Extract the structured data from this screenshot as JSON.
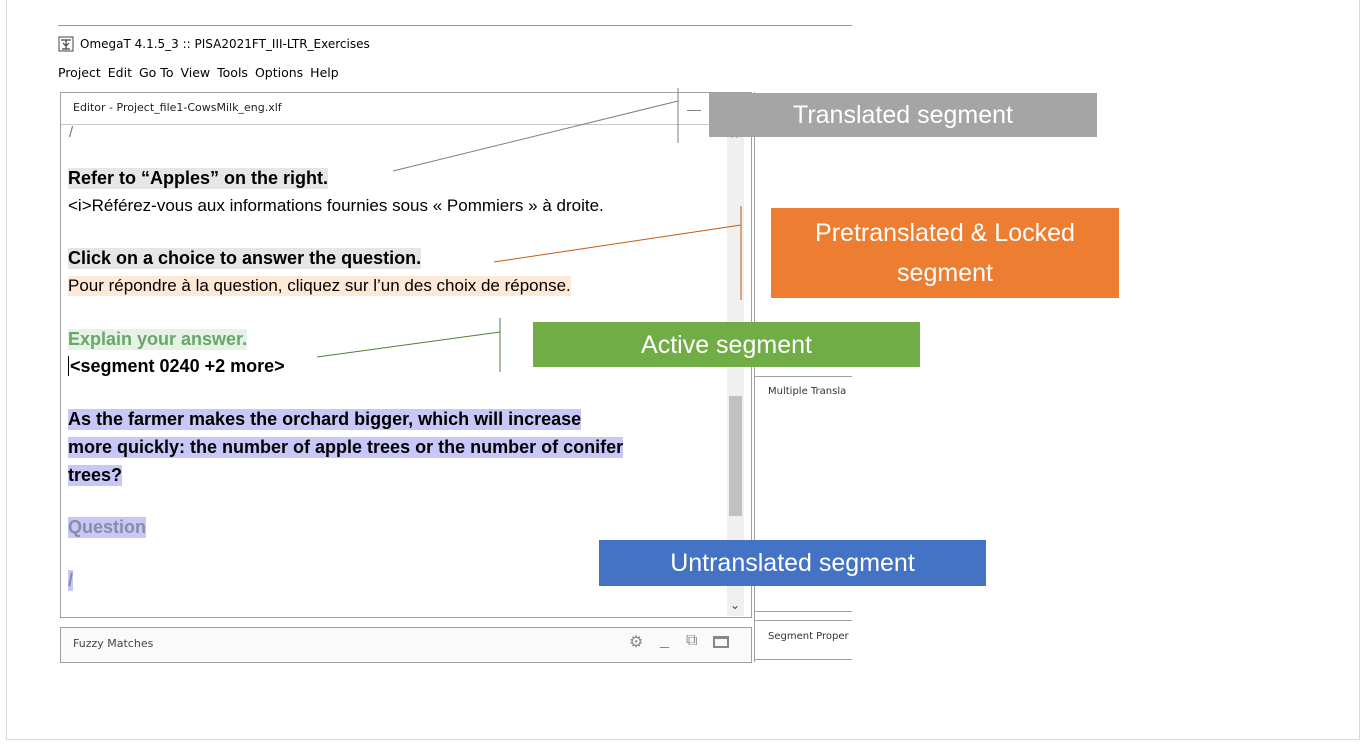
{
  "window": {
    "title": "OmegaT 4.1.5_3 :: PISA2021FT_III-LTR_Exercises"
  },
  "menu": [
    "Project",
    "Edit",
    "Go To",
    "View",
    "Tools",
    "Options",
    "Help"
  ],
  "editor": {
    "title": "Editor - Project_file1-CowsMilk_eng.xlf",
    "minimize": "—",
    "top_fragment": "/",
    "segments": {
      "translated_src": "Refer to “Apples” on the right.",
      "translated_tgt": "<i>Référez-vous aux informations fournies sous « Pommiers » à droite.",
      "locked_src": "Click on a choice to answer the question.",
      "locked_tgt": "Pour répondre à la question, cliquez sur l’un des choix de réponse.",
      "active_src": "Explain your answer.",
      "active_tgt": "<segment 0240 +2 more>",
      "untrans_line1": "As the farmer makes the orchard bigger, which will increase",
      "untrans_line2": "more quickly: the number of apple trees or the number of conifer",
      "untrans_line3": "trees?",
      "question": "Question",
      "slash": "/"
    }
  },
  "panels": {
    "multiple_translations": "Multiple Transla",
    "segment_properties": "Segment Proper",
    "fuzzy_matches": "Fuzzy Matches"
  },
  "callouts": {
    "translated": "Translated segment",
    "locked_line1": "Pretranslated & Locked",
    "locked_line2": "segment",
    "active": "Active segment",
    "untranslated": "Untranslated segment"
  },
  "colors": {
    "translated": "#a5a5a5",
    "locked": "#ed7d31",
    "active": "#70ad47",
    "untranslated": "#4472c4"
  }
}
